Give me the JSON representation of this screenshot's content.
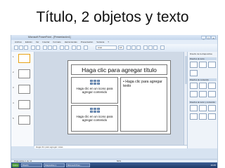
{
  "heading": "Título, 2 objetos y texto",
  "window": {
    "title": "Microsoft PowerPoint - [Presentación1]",
    "buttons": [
      "_",
      "□",
      "×"
    ]
  },
  "menu": [
    "Archivo",
    "Edición",
    "Ver",
    "Insertar",
    "Formato",
    "Herramientas",
    "Presentación",
    "Ventana",
    "?"
  ],
  "toolbar": {
    "font": "Arial",
    "size": "18"
  },
  "slides": {
    "numbers": [
      "1",
      "2",
      "3",
      "4",
      "5"
    ]
  },
  "slide": {
    "title": "Haga clic para agregar título",
    "content_placeholder": "Haga clic en un icono para agregar contenido",
    "text_placeholder": "Haga clic para agregar texto",
    "bullet": "•"
  },
  "notes": "Haga clic para agregar notas",
  "task_pane": {
    "title": "Diseño de la diapositiva",
    "sections": [
      "Diseños de texto",
      "Diseños de contenido",
      "Diseños de texto y contenido"
    ]
  },
  "status": {
    "left": "Diapositiva 1 de 11",
    "zoom": "50%"
  },
  "taskbar": {
    "start": "Inicio",
    "items": [
      "Diseño",
      "Diapositiva 1",
      "Microsoft Pow..."
    ],
    "clock": "19:45"
  },
  "colors": {
    "accent": "#e8a317",
    "ui_blue": "#d7e3f1",
    "taskbar": "#1e3a68"
  }
}
